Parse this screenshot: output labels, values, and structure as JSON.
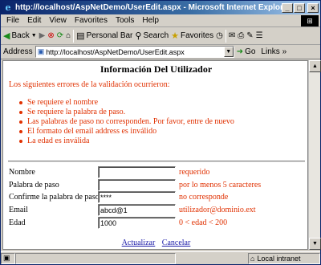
{
  "window": {
    "title": "http://localhost/AspNetDemo/UserEdit.aspx - Microsoft Internet Explorer"
  },
  "menu": [
    "File",
    "Edit",
    "View",
    "Favorites",
    "Tools",
    "Help"
  ],
  "toolbar": {
    "back": "Back",
    "personal_bar": "Personal Bar",
    "search": "Search",
    "favorites": "Favorites"
  },
  "address": {
    "label": "Address",
    "url": "http://localhost/AspNetDemo/UserEdit.aspx",
    "go": "Go",
    "links": "Links"
  },
  "page": {
    "title": "Información Del Utilizador",
    "validation_header": "Los siguientes errores de la validación ocurrieron:",
    "errors": [
      "Se requiere el nombre",
      "Se requiere la palabra de paso.",
      "Las palabras de paso no corresponden. Por favor, entre de nuevo",
      "El formato del email address es inválido",
      "La edad es inválida"
    ],
    "fields": [
      {
        "label": "Nombre",
        "value": "",
        "message": "requerido"
      },
      {
        "label": "Palabra de paso",
        "value": "",
        "message": "por lo menos 5 caracteres"
      },
      {
        "label": "Confirme la palabra de paso",
        "value": "****",
        "message": "no corresponde"
      },
      {
        "label": "Email",
        "value": "abcd@1",
        "message": "utilizador@dominio.ext"
      },
      {
        "label": "Edad",
        "value": "1000",
        "message": "0 < edad < 200"
      }
    ],
    "actions": {
      "update": "Actualizar",
      "cancel": "Cancelar"
    }
  },
  "status": {
    "zone": "Local intranet"
  },
  "colors": {
    "error": "#e03000",
    "link": "#1a1aa8",
    "titlebar": "#0a246a"
  }
}
